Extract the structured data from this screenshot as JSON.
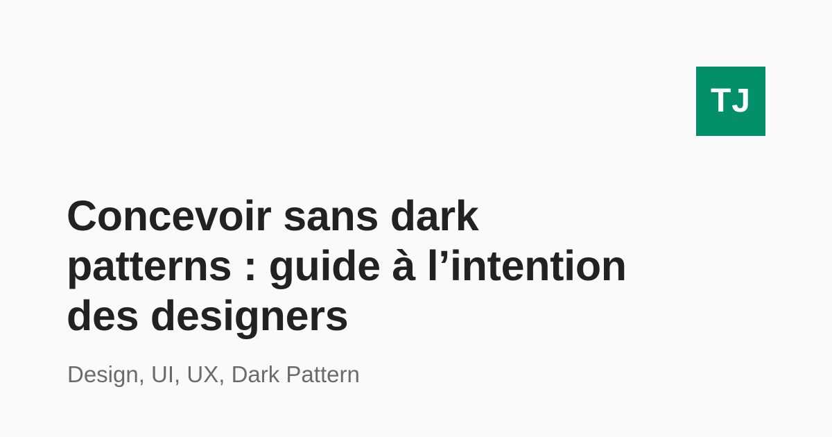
{
  "logo": {
    "text": "TJ",
    "background_color": "#048f6b",
    "text_color": "#ffffff"
  },
  "article": {
    "title": "Concevoir sans dark patterns : guide à l’intention des designers",
    "tags": "Design, UI, UX, Dark Pattern"
  },
  "colors": {
    "background": "#fafafa",
    "title": "#222222",
    "tags": "#6b6b6b"
  }
}
